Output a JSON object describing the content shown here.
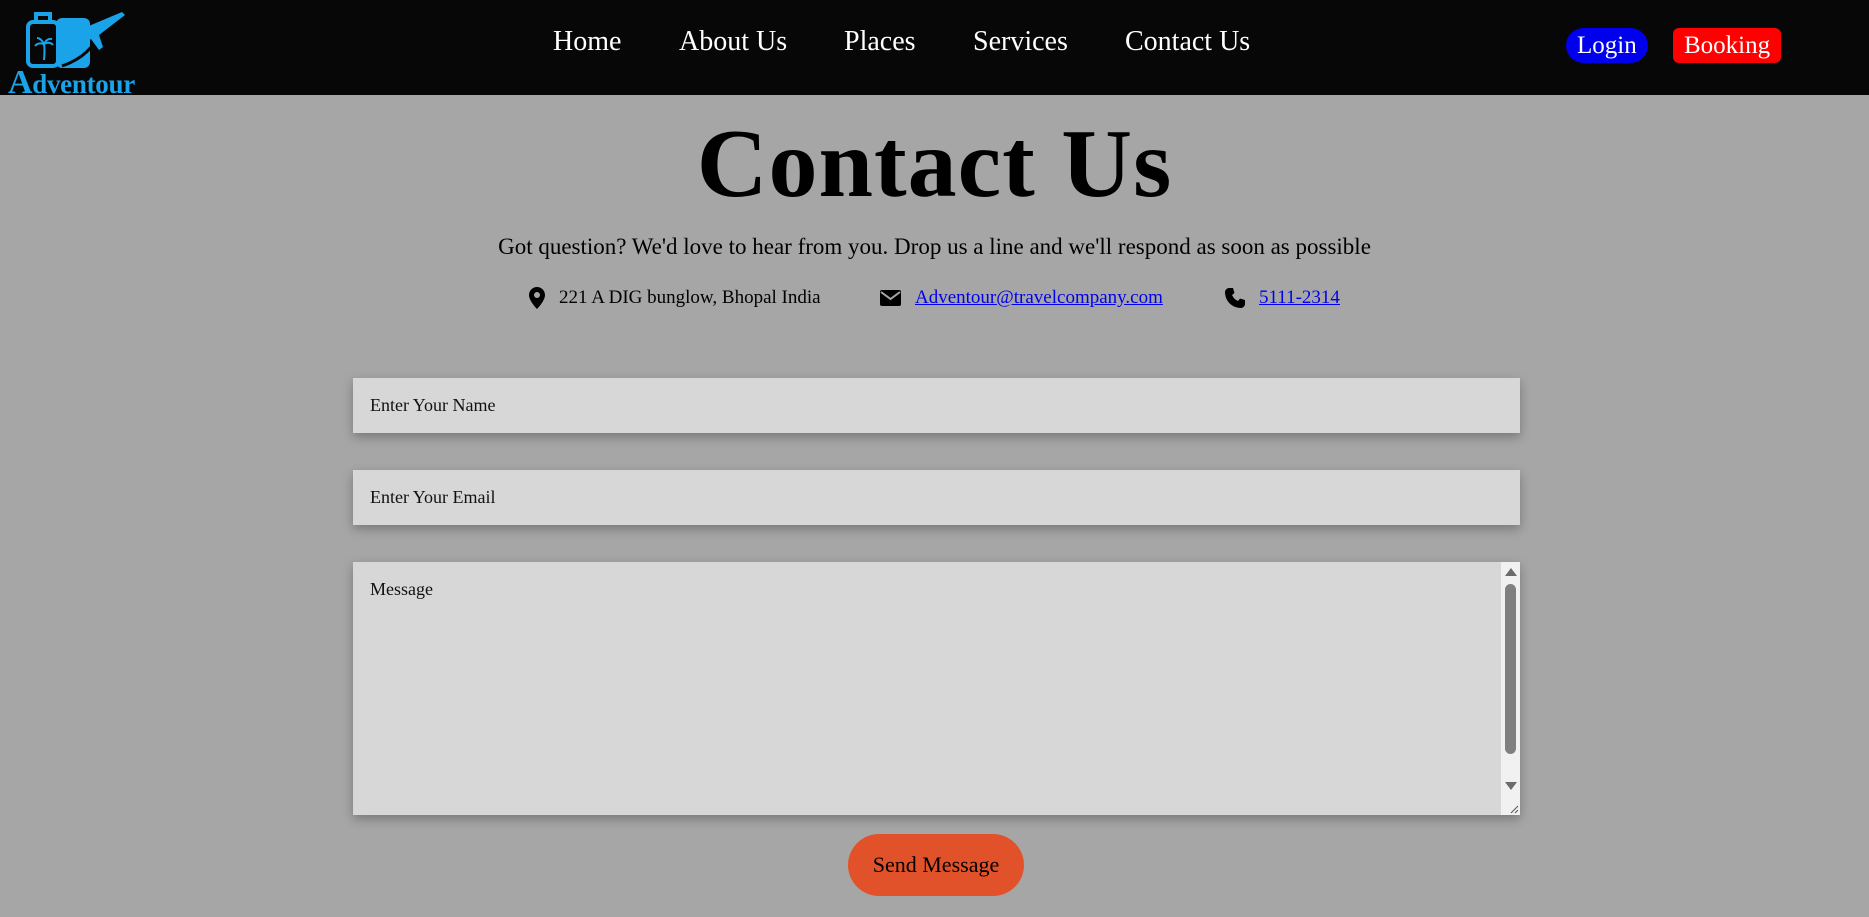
{
  "brand": {
    "name": "Adventour",
    "accent_color": "#1aa3e8"
  },
  "nav": {
    "items": [
      {
        "label": "Home"
      },
      {
        "label": "About Us"
      },
      {
        "label": "Places"
      },
      {
        "label": "Services"
      },
      {
        "label": "Contact Us"
      }
    ],
    "login_label": "Login",
    "login_color": "#0000ee",
    "booking_label": "Booking",
    "booking_color": "#ff0000"
  },
  "page": {
    "title": "Contact Us",
    "subtitle": "Got question? We'd love to hear from you. Drop us a line and we'll respond as soon as possible"
  },
  "contact_info": {
    "address": "221 A DIG bunglow, Bhopal India",
    "address_icon": "map-pin-icon",
    "email": "Adventour@travelcompany.com",
    "email_icon": "envelope-icon",
    "phone": "5111-2314",
    "phone_icon": "phone-icon"
  },
  "form": {
    "name_placeholder": "Enter Your Name",
    "email_placeholder": "Enter Your Email",
    "message_placeholder": "Message",
    "submit_label": "Send Message",
    "submit_color": "#e2522a"
  }
}
